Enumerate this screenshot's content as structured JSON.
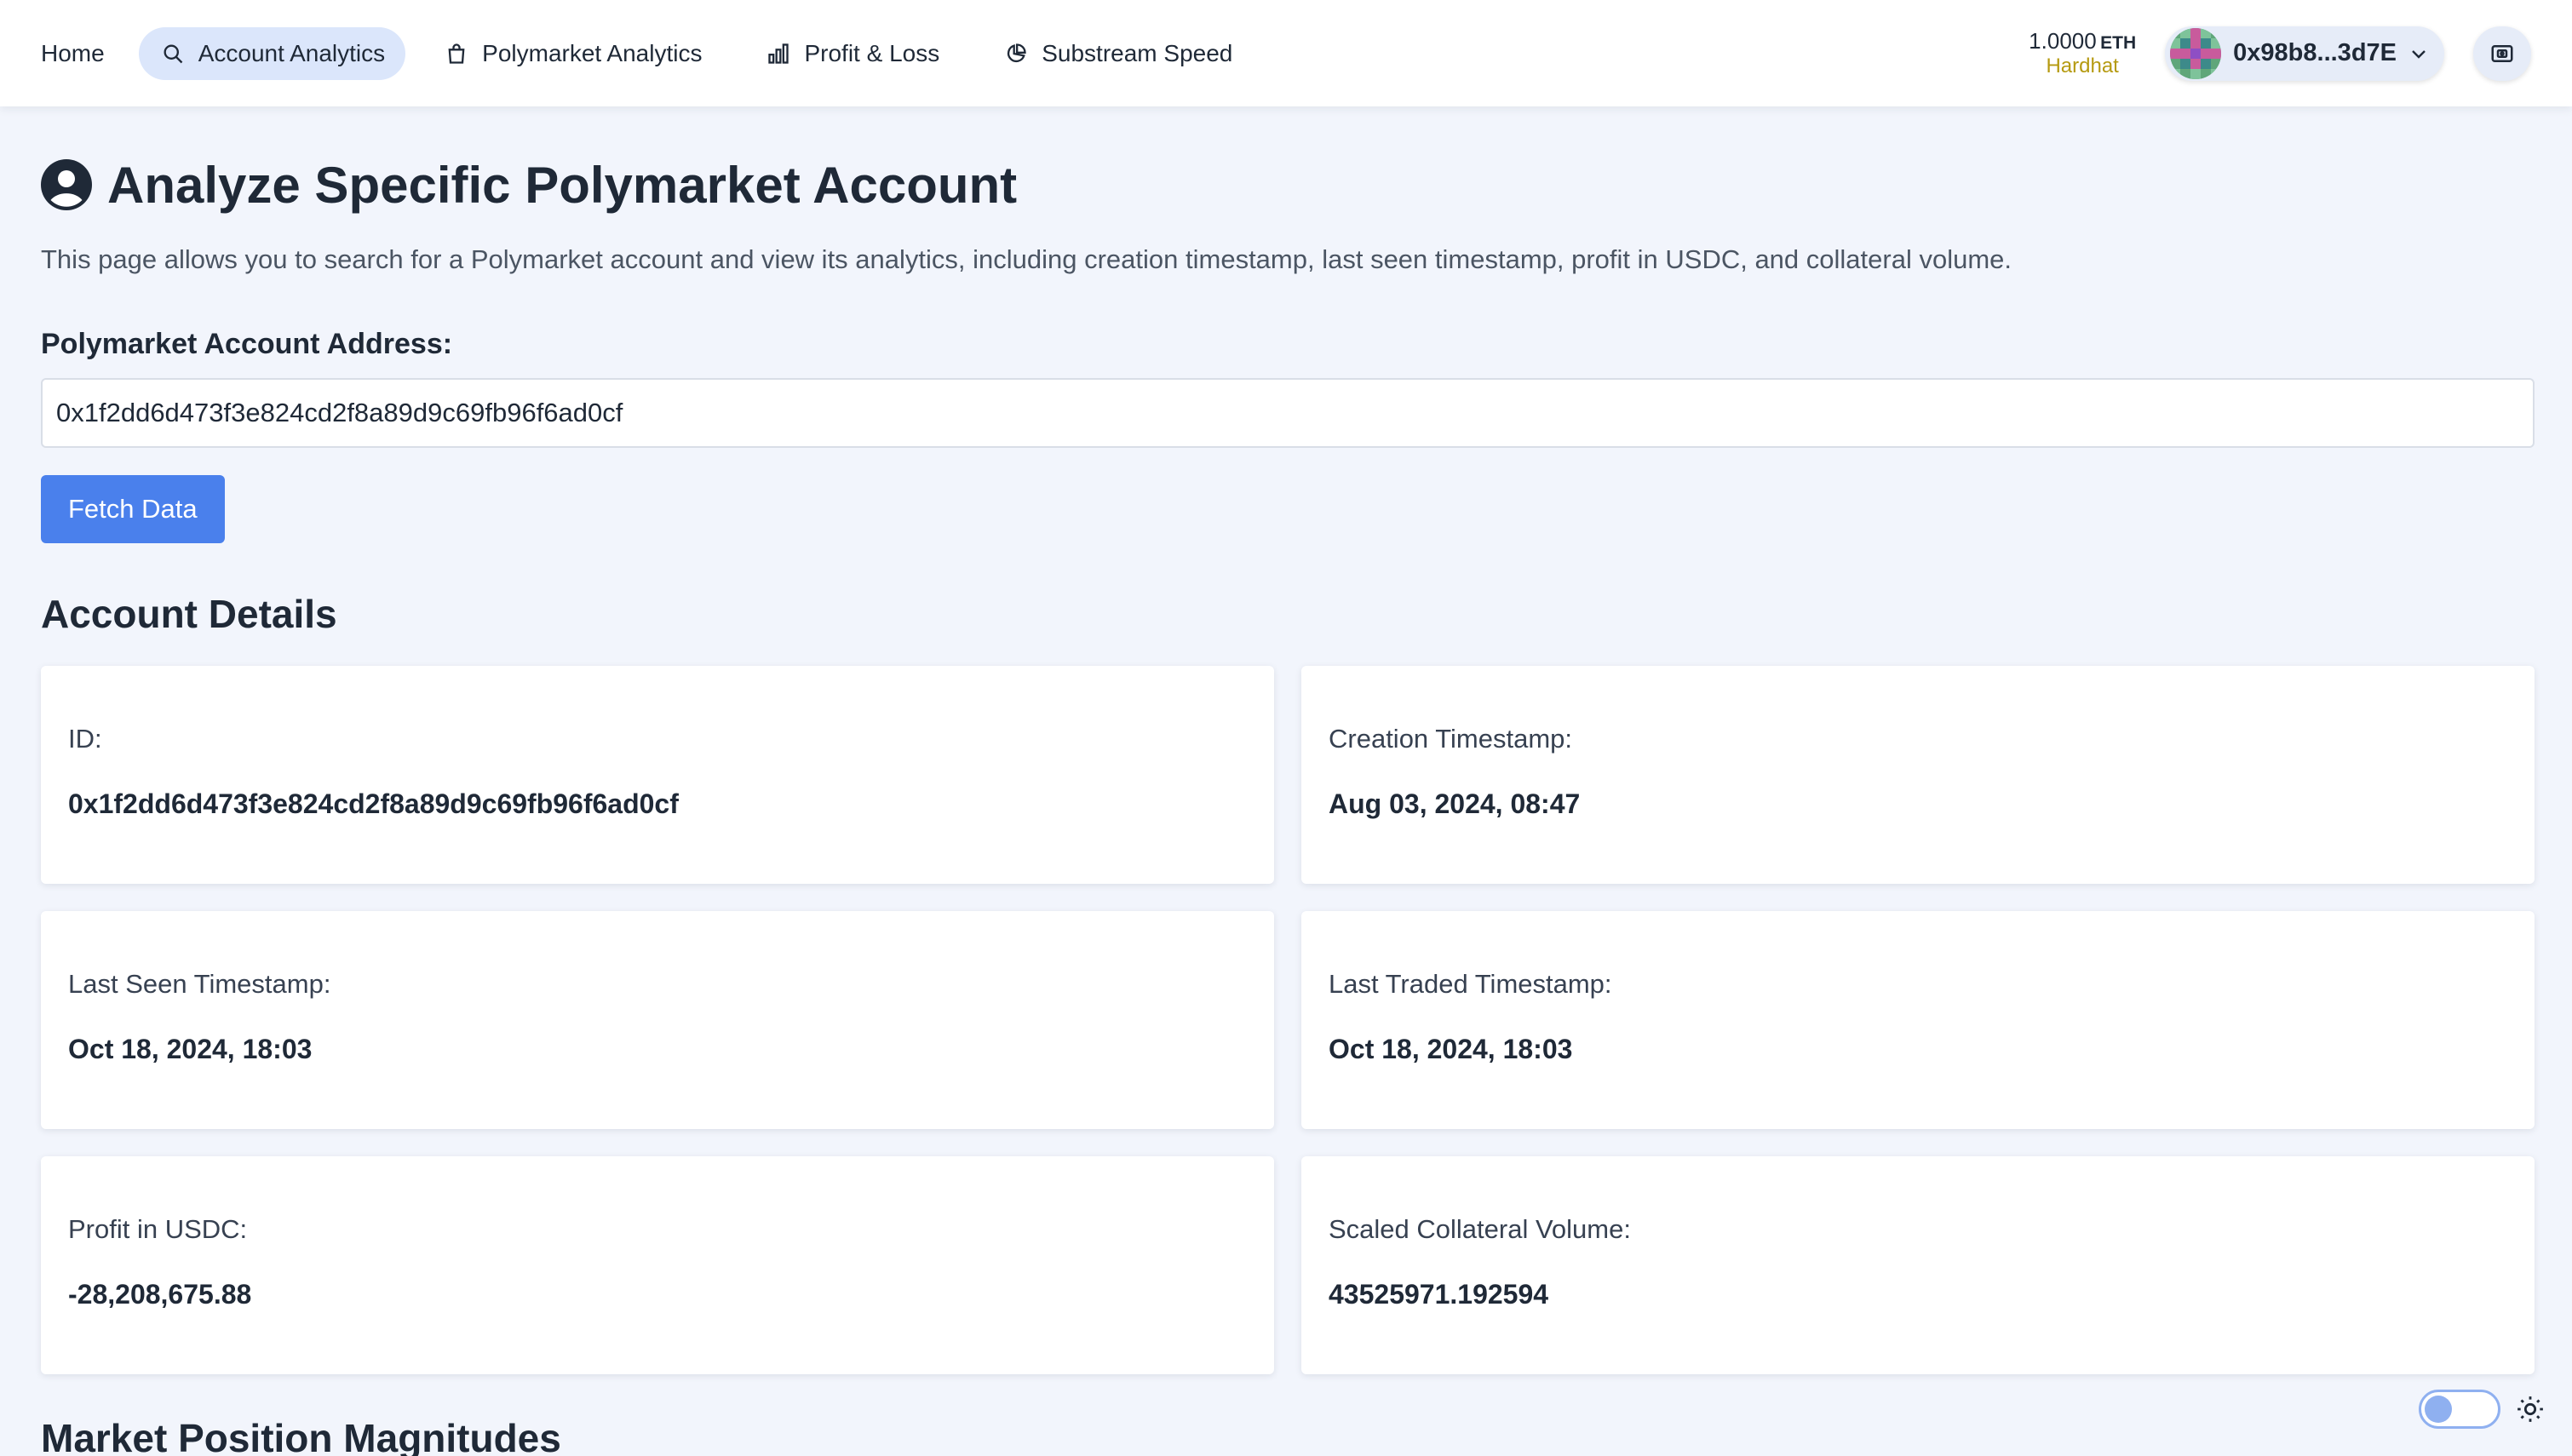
{
  "nav": {
    "links": [
      {
        "label": "Home",
        "icon": "none"
      },
      {
        "label": "Account Analytics",
        "icon": "search-icon",
        "active": true
      },
      {
        "label": "Polymarket Analytics",
        "icon": "shopping-bag-icon"
      },
      {
        "label": "Profit & Loss",
        "icon": "bar-chart-icon"
      },
      {
        "label": "Substream Speed",
        "icon": "pie-chart-icon"
      }
    ],
    "balance_amount": "1.0000",
    "balance_unit": "ETH",
    "network": "Hardhat",
    "account_address": "0x98b8...3d7E"
  },
  "page": {
    "title": "Analyze Specific Polymarket Account",
    "description": "This page allows you to search for a Polymarket account and view its analytics, including creation timestamp, last seen timestamp, profit in USDC, and collateral volume.",
    "address_label": "Polymarket Account Address:",
    "address_value": "0x1f2dd6d473f3e824cd2f8a89d9c69fb96f6ad0cf",
    "fetch_button": "Fetch Data",
    "details_title": "Account Details",
    "magnitudes_title": "Market Position Magnitudes"
  },
  "details": {
    "id": {
      "label": "ID:",
      "value": "0x1f2dd6d473f3e824cd2f8a89d9c69fb96f6ad0cf"
    },
    "creation": {
      "label": "Creation Timestamp:",
      "value": "Aug 03, 2024, 08:47"
    },
    "last_seen": {
      "label": "Last Seen Timestamp:",
      "value": "Oct 18, 2024, 18:03"
    },
    "last_traded": {
      "label": "Last Traded Timestamp:",
      "value": "Oct 18, 2024, 18:03"
    },
    "profit": {
      "label": "Profit in USDC:",
      "value": "-28,208,675.88"
    },
    "collateral": {
      "label": "Scaled Collateral Volume:",
      "value": "43525971.192594"
    }
  },
  "colors": {
    "accent": "#4a80ec",
    "active_nav_bg": "#dbe6fb",
    "network_label": "#b59a10",
    "page_bg": "#f2f5fc"
  }
}
